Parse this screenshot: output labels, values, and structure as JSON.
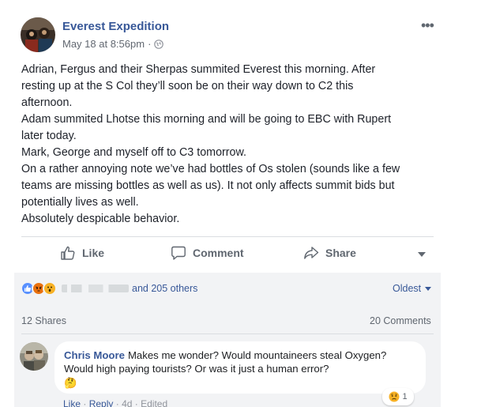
{
  "post": {
    "page_name": "Everest Expedition",
    "date": "May 18 at 8:56pm",
    "separator": "·",
    "more": "•••",
    "lines": [
      "Adrian, Fergus and their Sherpas summited Everest this morning. After",
      "resting up at the S Col they’ll soon be on their way down to C2 this",
      "afternoon.",
      "Adam summited Lhotse this morning and will be going to EBC with Rupert",
      "later today.",
      "Mark, George and myself off to C3 tomorrow.",
      "On a rather annoying note we’ve had bottles of Os stolen (sounds like a few",
      "teams are missing bottles as well as us). It not only affects summit bids but",
      "potentially lives as well.",
      "Absolutely despicable behavior."
    ]
  },
  "actions": {
    "like": "Like",
    "comment": "Comment",
    "share": "Share"
  },
  "reactions": {
    "icons": [
      "like-icon",
      "angry-icon",
      "wow-icon"
    ],
    "others": "and 205 others",
    "sort": "Oldest",
    "shares": "12 Shares",
    "comments": "20 Comments"
  },
  "comment": {
    "author": "Chris Moore",
    "text": "Makes me wonder? Would mountaineers steal Oxygen? Would high paying tourists? Or was it just a human error?",
    "emoji": "🤔",
    "reaction_count": "1",
    "like": "Like",
    "reply": "Reply",
    "age": "4d",
    "edited": "Edited",
    "dot": "·"
  },
  "colors": {
    "link": "#385898",
    "like_reaction": "#5890ff",
    "angry_reaction": "#e9710f",
    "wow_reaction": "#f7b125"
  }
}
